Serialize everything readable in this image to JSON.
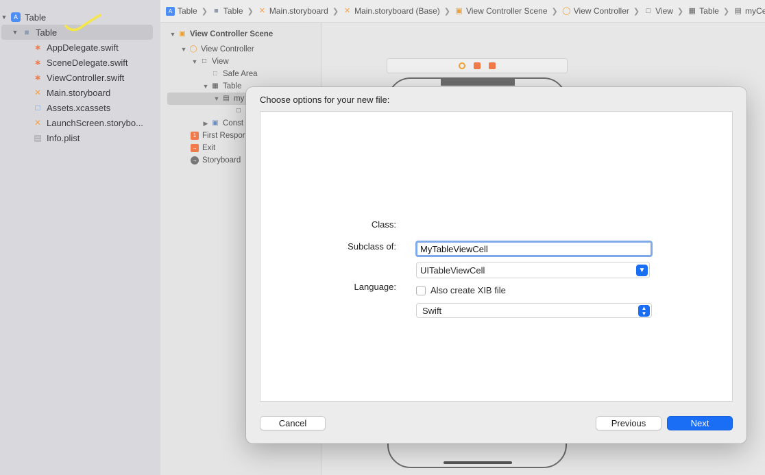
{
  "navigator": {
    "items": [
      {
        "label": "Table",
        "icon": "project-icon"
      },
      {
        "label": "Table",
        "icon": "folder-icon"
      },
      {
        "label": "AppDelegate.swift",
        "icon": "swift-file-icon"
      },
      {
        "label": "SceneDelegate.swift",
        "icon": "swift-file-icon"
      },
      {
        "label": "ViewController.swift",
        "icon": "swift-file-icon"
      },
      {
        "label": "Main.storyboard",
        "icon": "storyboard-icon"
      },
      {
        "label": "Assets.xcassets",
        "icon": "assets-icon"
      },
      {
        "label": "LaunchScreen.storybo...",
        "icon": "storyboard-icon"
      },
      {
        "label": "Info.plist",
        "icon": "plist-icon"
      }
    ]
  },
  "jumpbar": {
    "crumbs": [
      "Table",
      "Table",
      "Main.storyboard",
      "Main.storyboard (Base)",
      "View Controller Scene",
      "View Controller",
      "View",
      "Table",
      "myCell"
    ]
  },
  "outline": {
    "rows": [
      "View Controller Scene",
      "View Controller",
      "View",
      "Safe Area",
      "Table",
      "my",
      "",
      "Const",
      "First Respor",
      "Exit",
      "Storyboard"
    ]
  },
  "sheet": {
    "title": "Choose options for your new file:",
    "class_label": "Class:",
    "class_value": "MyTableViewCell",
    "subclass_label": "Subclass of:",
    "subclass_value": "UITableViewCell",
    "xib_label": "Also create XIB file",
    "xib_checked": false,
    "language_label": "Language:",
    "language_value": "Swift",
    "cancel_label": "Cancel",
    "previous_label": "Previous",
    "next_label": "Next"
  },
  "colors": {
    "accent": "#1a6ef5",
    "annotation": "#f5e64a"
  }
}
